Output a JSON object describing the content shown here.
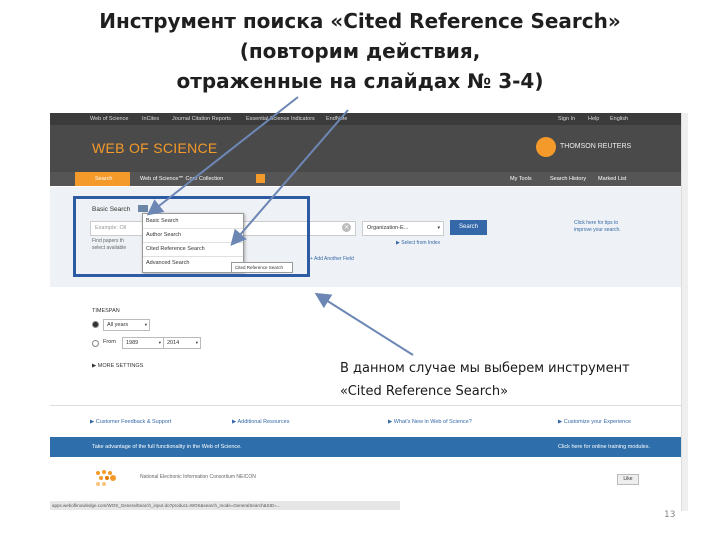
{
  "slide": {
    "title_lines": [
      "Инструмент поиска «Cited Reference Search»",
      "(повторим действия,",
      "отраженные на слайдах № 3-4)"
    ],
    "callout_lines": [
      "В данном случае мы выберем инструмент",
      "«Cited Reference Search»"
    ],
    "page_number": "13"
  },
  "browser": {
    "topbar": {
      "links": [
        "Web of Science",
        "InCites",
        "Journal Citation Reports",
        "Essential Science Indicators",
        "EndNote"
      ],
      "right": [
        "Sign In",
        "Help",
        "English"
      ]
    },
    "header": {
      "logo": "WEB OF SCIENCE",
      "publisher": "THOMSON REUTERS"
    },
    "nav": {
      "search_tab": "Search",
      "database": "Web of Science℠ Core Collection",
      "right": [
        "My Tools",
        "Search History",
        "Marked List"
      ]
    },
    "search": {
      "mode_label": "Basic Search",
      "query_placeholder": "Example: Oil",
      "hint_lines": [
        "Find papers th",
        "select available"
      ],
      "field_select": "Organization-E...",
      "search_button": "Search",
      "select_list": "Select from Index",
      "add_field": "+ Add Another Field",
      "tips_lines": [
        "Click here for tips to",
        "improve your search."
      ]
    },
    "dropdown": {
      "items": [
        "Basic Search",
        "Author Search",
        "Cited Reference Search",
        "Advanced Search"
      ],
      "tooltip": "Cited Reference Search"
    },
    "timespan": {
      "label": "TIMESPAN",
      "all_years": "All years",
      "from_label": "From",
      "from_year": "1989",
      "to_label": "to",
      "to_year": "2014"
    },
    "more_settings": "MORE SETTINGS",
    "footer_links": [
      "Customer Feedback & Support",
      "Additional Resources",
      "What's New in Web of Science?",
      "Customize your Experience"
    ],
    "promo": {
      "left": "Take advantage of the full functionality in the Web of Science.",
      "right": "Click here for online training modules."
    },
    "bottom": {
      "nsdl_text": "National Electronic Information Consortium NEICON",
      "like": "Like"
    },
    "status_bar": "apps.webofknowledge.com/WOS_GeneralSearch_input.do?product=WOS&search_mode=GeneralSearch&SID=..."
  },
  "colors": {
    "accent_orange": "#f39a2b",
    "highlight_blue": "#2c5aa3",
    "header_dark": "#4a4a4a",
    "promo_blue": "#2e6fab"
  }
}
